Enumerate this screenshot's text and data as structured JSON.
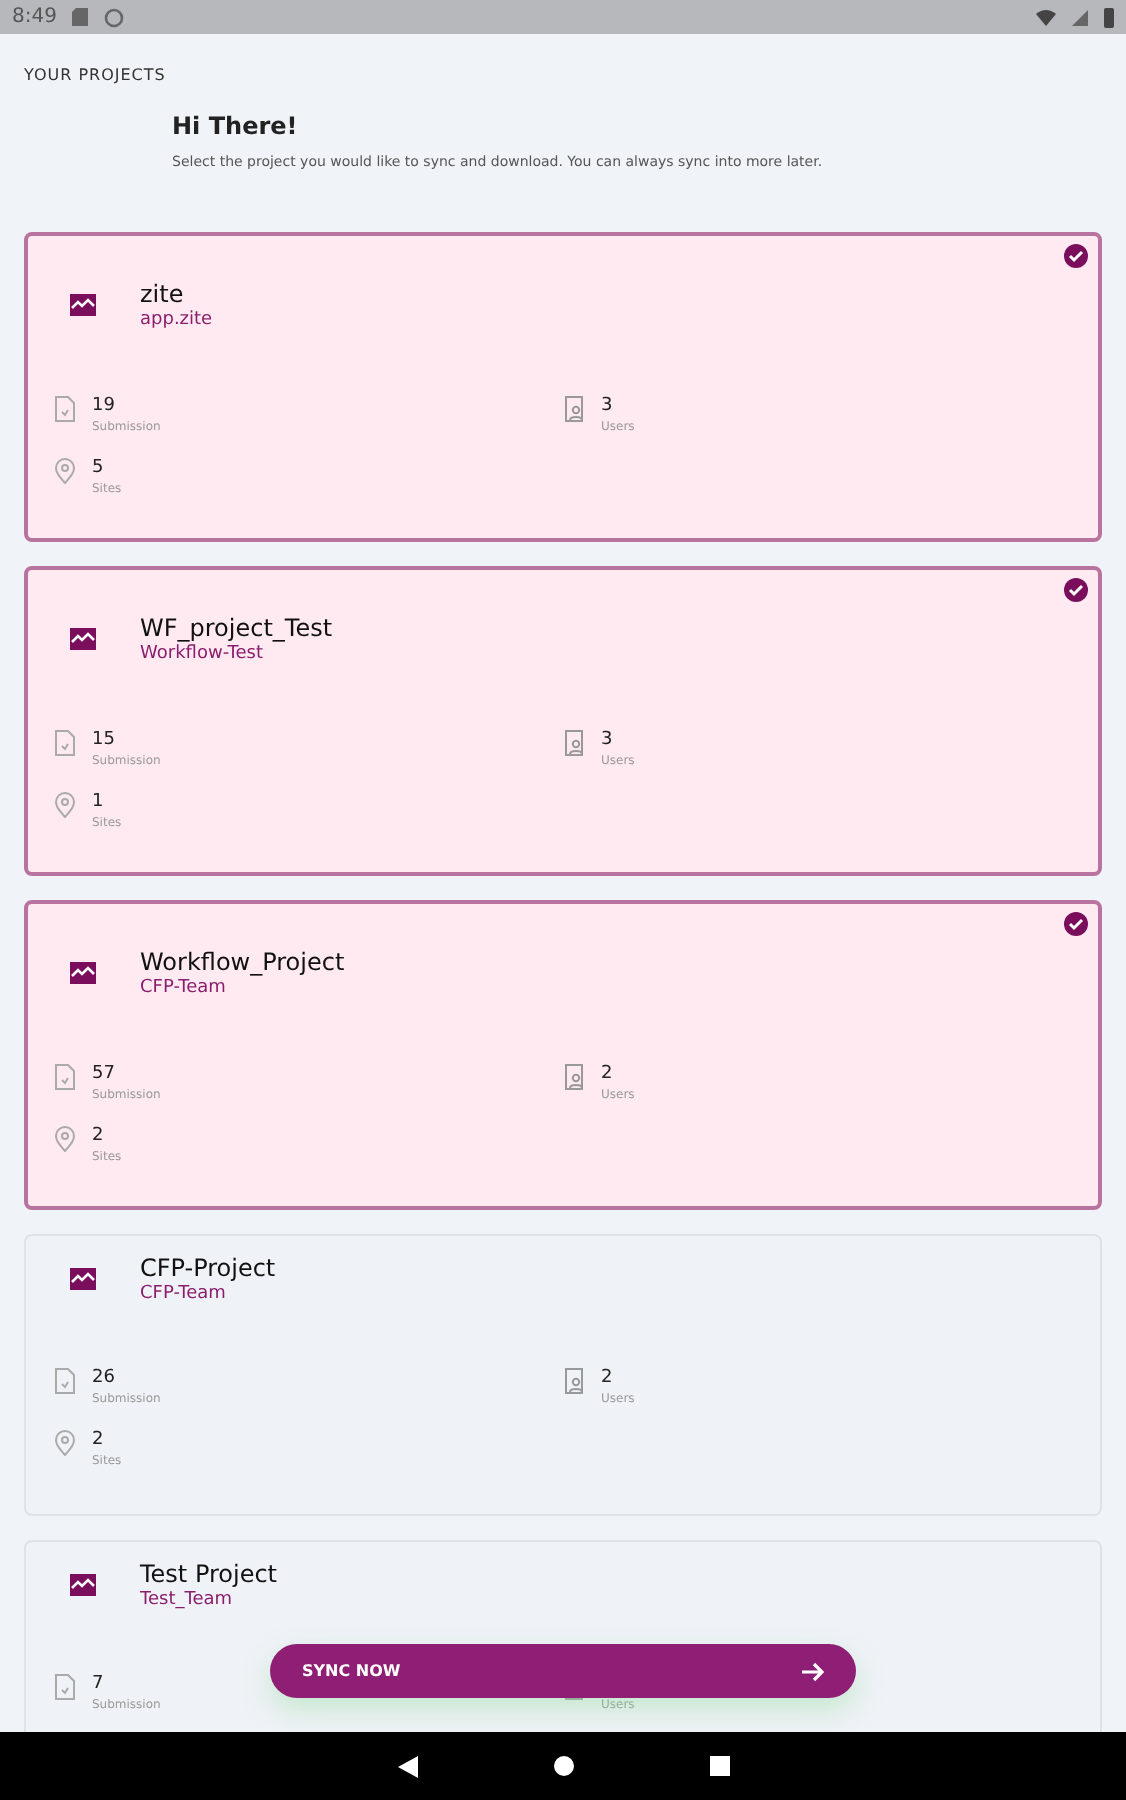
{
  "status_bar": {
    "time": "8:49"
  },
  "header": {
    "title": "YOUR PROJECTS"
  },
  "intro": {
    "greeting": "Hi There!",
    "message": "Select the project you would like to sync and download. You can always sync into more later."
  },
  "projects": [
    {
      "name": "zite",
      "team": "app.zite",
      "selected": true,
      "stats": [
        {
          "kind": "submission",
          "value": "19",
          "label": "Submission"
        },
        {
          "kind": "users",
          "value": "3",
          "label": "Users"
        },
        {
          "kind": "sites",
          "value": "5",
          "label": "Sites"
        }
      ]
    },
    {
      "name": "WF_project_Test",
      "team": "Workflow-Test",
      "selected": true,
      "stats": [
        {
          "kind": "submission",
          "value": "15",
          "label": "Submission"
        },
        {
          "kind": "users",
          "value": "3",
          "label": "Users"
        },
        {
          "kind": "sites",
          "value": "1",
          "label": "Sites"
        }
      ]
    },
    {
      "name": "Workflow_Project",
      "team": "CFP-Team",
      "selected": true,
      "stats": [
        {
          "kind": "submission",
          "value": "57",
          "label": "Submission"
        },
        {
          "kind": "users",
          "value": "2",
          "label": "Users"
        },
        {
          "kind": "sites",
          "value": "2",
          "label": "Sites"
        }
      ]
    },
    {
      "name": "CFP-Project",
      "team": "CFP-Team",
      "selected": false,
      "stats": [
        {
          "kind": "submission",
          "value": "26",
          "label": "Submission"
        },
        {
          "kind": "users",
          "value": "2",
          "label": "Users"
        },
        {
          "kind": "sites",
          "value": "2",
          "label": "Sites"
        }
      ]
    },
    {
      "name": "Test Project",
      "team": "Test_Team",
      "selected": false,
      "stats": [
        {
          "kind": "submission",
          "value": "7",
          "label": "Submission"
        },
        {
          "kind": "users",
          "label": "Users"
        }
      ]
    }
  ],
  "sync_button": {
    "label": "SYNC NOW"
  }
}
